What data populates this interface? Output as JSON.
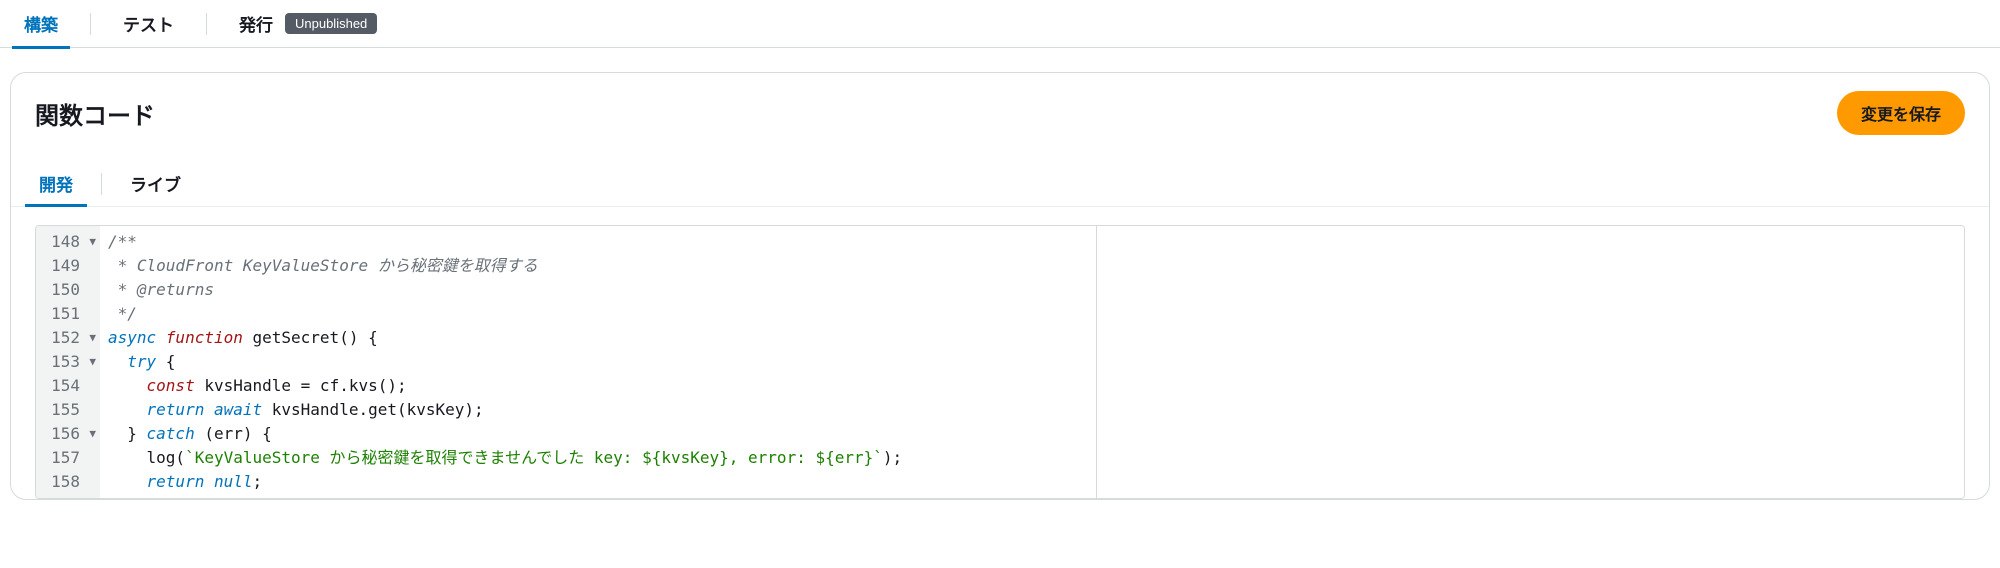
{
  "top_tabs": {
    "build": "構築",
    "test": "テスト",
    "publish": "発行",
    "publish_badge": "Unpublished",
    "active": "build"
  },
  "panel": {
    "title": "関数コード",
    "save_label": "変更を保存"
  },
  "inner_tabs": {
    "dev": "開発",
    "live": "ライブ",
    "active": "dev"
  },
  "editor": {
    "lines": [
      {
        "n": 148,
        "fold": true,
        "tokens": [
          [
            "comment",
            "/**"
          ]
        ]
      },
      {
        "n": 149,
        "fold": false,
        "tokens": [
          [
            "comment",
            " * CloudFront KeyValueStore から秘密鍵を取得する"
          ]
        ]
      },
      {
        "n": 150,
        "fold": false,
        "tokens": [
          [
            "comment",
            " * @returns"
          ]
        ]
      },
      {
        "n": 151,
        "fold": false,
        "tokens": [
          [
            "comment",
            " */"
          ]
        ]
      },
      {
        "n": 152,
        "fold": true,
        "tokens": [
          [
            "keyword",
            "async "
          ],
          [
            "keyword2",
            "function"
          ],
          [
            "plain",
            " getSecret() {"
          ]
        ]
      },
      {
        "n": 153,
        "fold": true,
        "tokens": [
          [
            "plain",
            "  "
          ],
          [
            "keyword",
            "try"
          ],
          [
            "plain",
            " {"
          ]
        ]
      },
      {
        "n": 154,
        "fold": false,
        "tokens": [
          [
            "plain",
            "    "
          ],
          [
            "const",
            "const"
          ],
          [
            "plain",
            " kvsHandle = cf.kvs();"
          ]
        ]
      },
      {
        "n": 155,
        "fold": false,
        "tokens": [
          [
            "plain",
            "    "
          ],
          [
            "keyword",
            "return await"
          ],
          [
            "plain",
            " kvsHandle.get(kvsKey);"
          ]
        ]
      },
      {
        "n": 156,
        "fold": true,
        "tokens": [
          [
            "plain",
            "  } "
          ],
          [
            "keyword",
            "catch"
          ],
          [
            "plain",
            " (err) {"
          ]
        ]
      },
      {
        "n": 157,
        "fold": false,
        "tokens": [
          [
            "plain",
            "    log("
          ],
          [
            "string",
            "`KeyValueStore から秘密鍵を取得できませんでした key: ${kvsKey}, error: ${err}`"
          ],
          [
            "plain",
            ");"
          ]
        ]
      },
      {
        "n": 158,
        "fold": false,
        "tokens": [
          [
            "plain",
            "    "
          ],
          [
            "keyword",
            "return null"
          ],
          [
            "plain",
            ";"
          ]
        ]
      }
    ]
  }
}
